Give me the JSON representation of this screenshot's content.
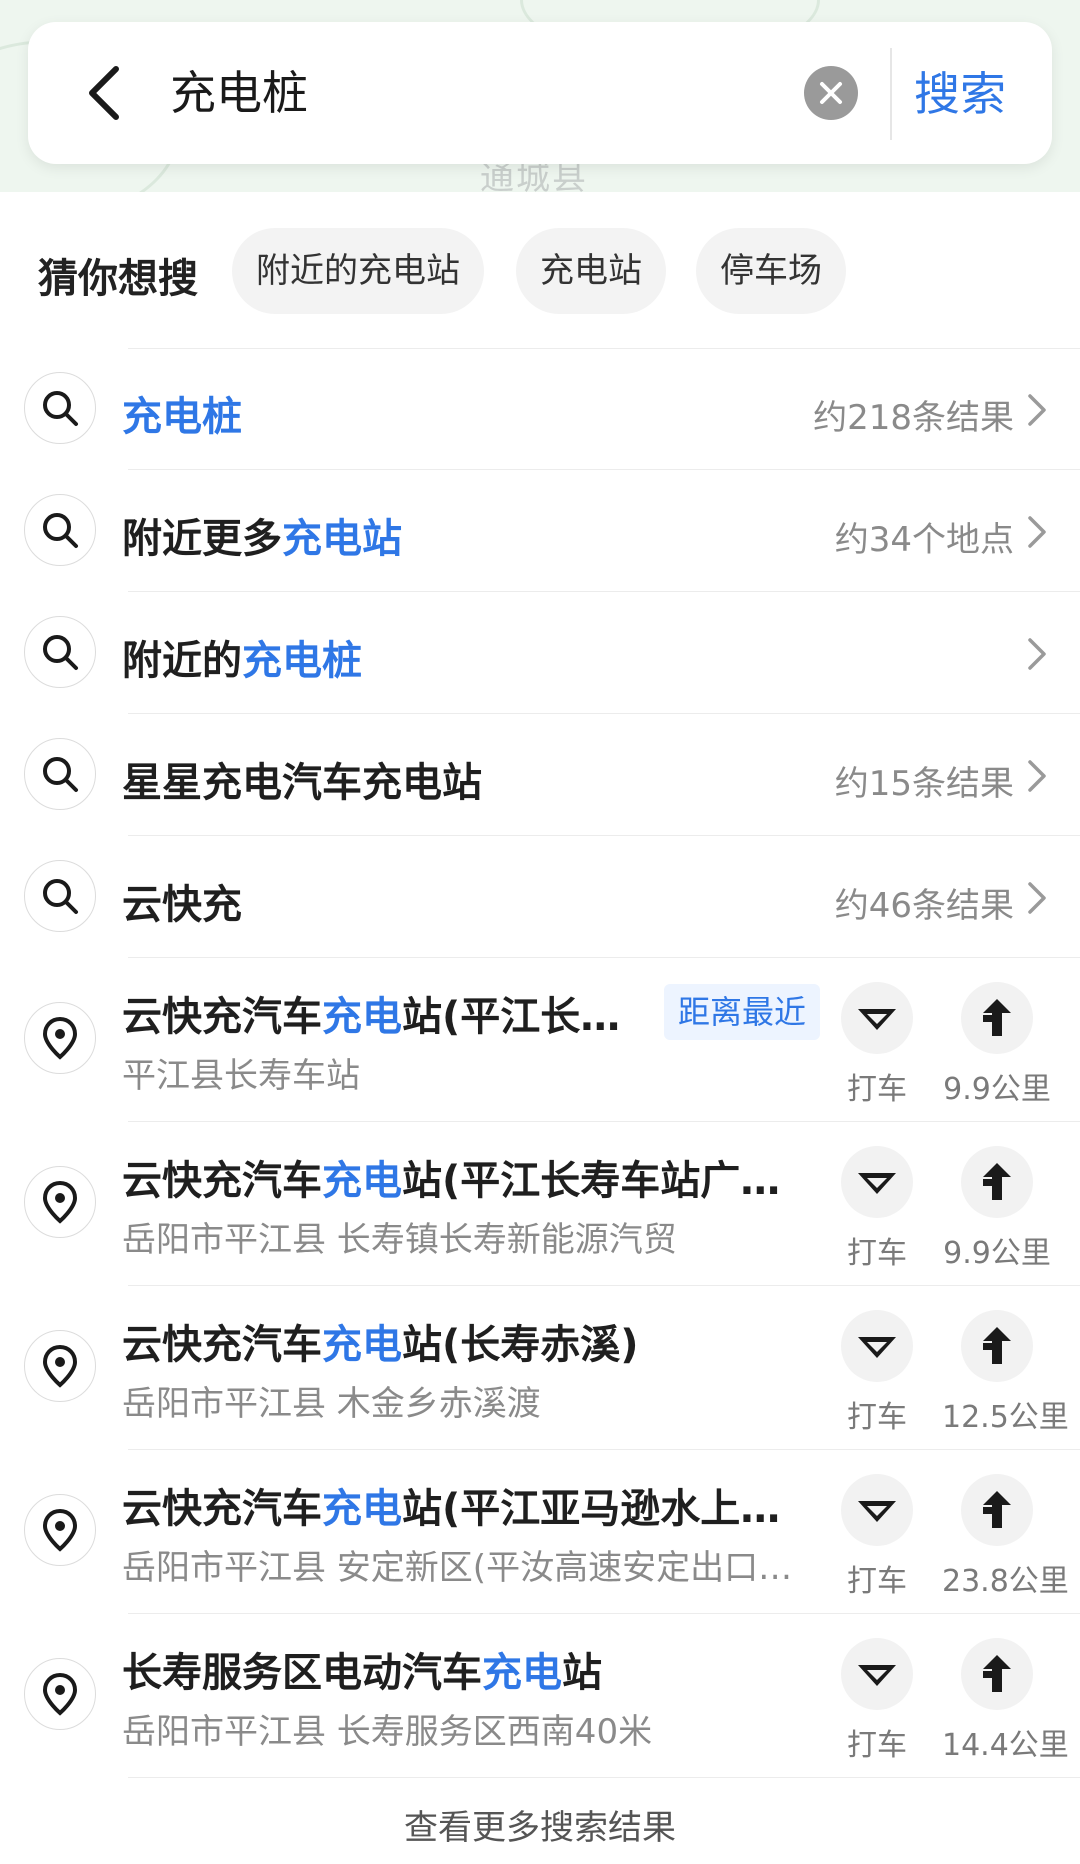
{
  "map": {
    "ghost_label": "通城县"
  },
  "search": {
    "query": "充电桩",
    "submit_label": "搜索"
  },
  "guess": {
    "title": "猜你想搜",
    "chips": [
      "附近的充电站",
      "充电站",
      "停车场"
    ]
  },
  "suggestions": [
    {
      "prefix": "",
      "highlight": "充电桩",
      "suffix": "",
      "meta": "约218条结果"
    },
    {
      "prefix": "附近更多",
      "highlight": "充电站",
      "suffix": "",
      "meta": "约34个地点"
    },
    {
      "prefix": "附近的",
      "highlight": "充电桩",
      "suffix": "",
      "meta": ""
    },
    {
      "prefix": "星星充电汽车充电站",
      "highlight": "",
      "suffix": "",
      "meta": "约15条结果"
    },
    {
      "prefix": "云快充",
      "highlight": "",
      "suffix": "",
      "meta": "约46条结果"
    }
  ],
  "places": [
    {
      "prefix": "云快充汽车",
      "highlight": "充电",
      "suffix": "站(平江长…",
      "badge": "距离最近",
      "address": "平江县长寿车站",
      "taxi_label": "打车",
      "distance": "9.9公里"
    },
    {
      "prefix": "云快充汽车",
      "highlight": "充电",
      "suffix": "站(平江长寿车站广…",
      "badge": "",
      "address": "岳阳市平江县 长寿镇长寿新能源汽贸",
      "taxi_label": "打车",
      "distance": "9.9公里"
    },
    {
      "prefix": "云快充汽车",
      "highlight": "充电",
      "suffix": "站(长寿赤溪)",
      "badge": "",
      "address": "岳阳市平江县 木金乡赤溪渡",
      "taxi_label": "打车",
      "distance": "12.5公里"
    },
    {
      "prefix": "云快充汽车",
      "highlight": "充电",
      "suffix": "站(平江亚马逊水上…",
      "badge": "",
      "address": "岳阳市平江县 安定新区(平汝高速安定出口…",
      "taxi_label": "打车",
      "distance": "23.8公里"
    },
    {
      "prefix": "长寿服务区电动汽车",
      "highlight": "充电",
      "suffix": "站",
      "badge": "",
      "address": "岳阳市平江县 长寿服务区西南40米",
      "taxi_label": "打车",
      "distance": "14.4公里"
    }
  ],
  "footer": {
    "more_label": "查看更多搜索结果"
  },
  "colors": {
    "accent": "#2f77e6",
    "muted": "#8a8a8a"
  }
}
